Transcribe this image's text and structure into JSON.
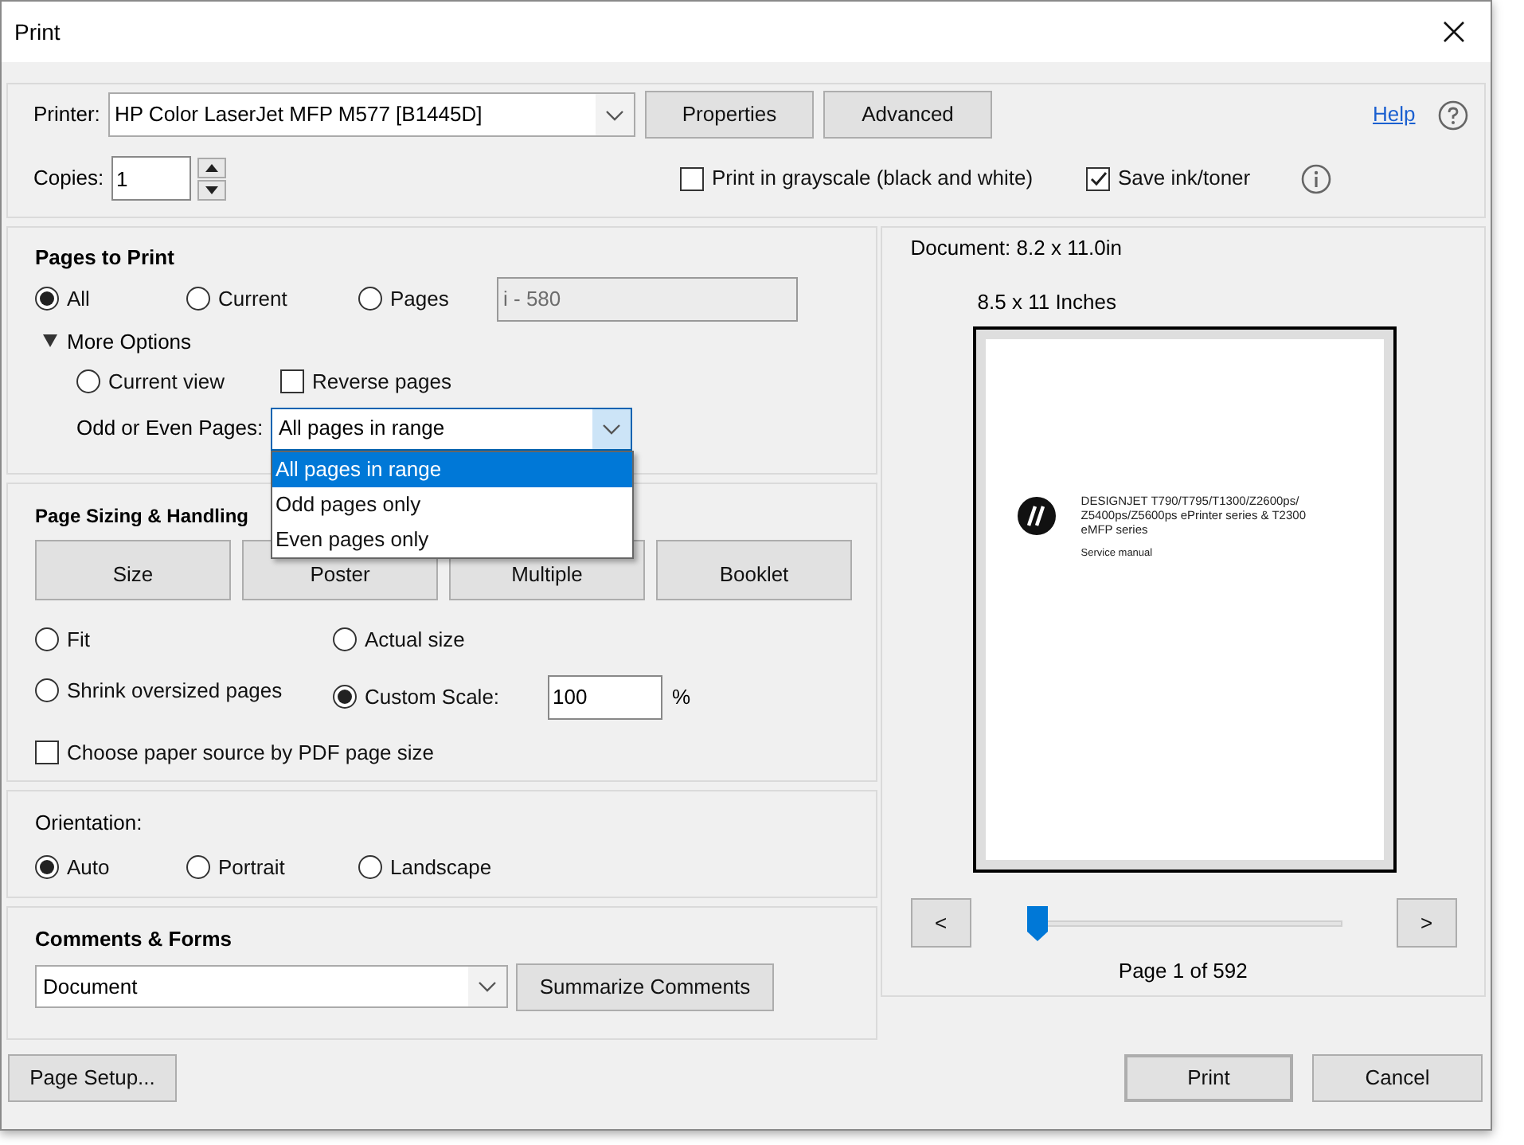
{
  "window": {
    "title": "Print"
  },
  "printer": {
    "label": "Printer:",
    "value": "HP Color LaserJet MFP M577 [B1445D]",
    "buttons": [
      "Properties",
      "Advanced"
    ],
    "help": "Help"
  },
  "copies": {
    "label": "Copies:",
    "value": "1"
  },
  "grayscale": {
    "label": "Print in grayscale (black and white)",
    "checked": false
  },
  "save_ink": {
    "label": "Save ink/toner",
    "checked": true
  },
  "pages_to_print": {
    "title": "Pages to Print",
    "options": [
      {
        "label": "All",
        "selected": true
      },
      {
        "label": "Current",
        "selected": false
      },
      {
        "label": "Pages",
        "selected": false
      }
    ],
    "range": {
      "value": "i - 580",
      "disabled": true
    },
    "more_options": {
      "label": "More Options",
      "expanded": true
    },
    "current_view": {
      "label": "Current view",
      "selected": false
    },
    "reverse": {
      "label": "Reverse pages",
      "checked": false
    },
    "odd_even": {
      "label": "Odd or Even Pages:",
      "value": "All pages in range",
      "open": true,
      "options": [
        {
          "label": "All pages in range",
          "selected": true
        },
        {
          "label": "Odd pages only",
          "selected": false
        },
        {
          "label": "Even pages only",
          "selected": false
        }
      ]
    }
  },
  "page_sizing": {
    "title": "Page Sizing & Handling",
    "modes": [
      "Size",
      "Poster",
      "Multiple",
      "Booklet"
    ],
    "scaling": [
      {
        "label": "Fit",
        "selected": false
      },
      {
        "label": "Actual size",
        "selected": false
      },
      {
        "label": "Shrink oversized pages",
        "selected": false
      },
      {
        "label": "Custom Scale:",
        "selected": true
      }
    ],
    "scale": {
      "value": "100",
      "unit": "%"
    },
    "paper_source": {
      "label": "Choose paper source by PDF page size",
      "checked": false
    }
  },
  "orientation": {
    "title": "Orientation:",
    "options": [
      {
        "label": "Auto",
        "selected": true
      },
      {
        "label": "Portrait",
        "selected": false
      },
      {
        "label": "Landscape",
        "selected": false
      }
    ]
  },
  "comments": {
    "title": "Comments & Forms",
    "value": "Document",
    "button": "Summarize Comments"
  },
  "preview": {
    "document_size": "Document: 8.2 x 11.0in",
    "paper_size": "8.5 x 11 Inches",
    "page": {
      "heading": [
        "DESIGNJET T790/T795/T1300/Z2600ps/",
        "Z5400ps/Z5600ps ePrinter series & T2300",
        "eMFP series"
      ],
      "subtitle": "Service manual"
    },
    "prev": "<",
    "next": ">",
    "slider": {
      "level": 0
    },
    "page_label": "Page 1 of 592"
  },
  "footer": {
    "page_setup": "Page Setup...",
    "print": "Print",
    "cancel": "Cancel"
  }
}
